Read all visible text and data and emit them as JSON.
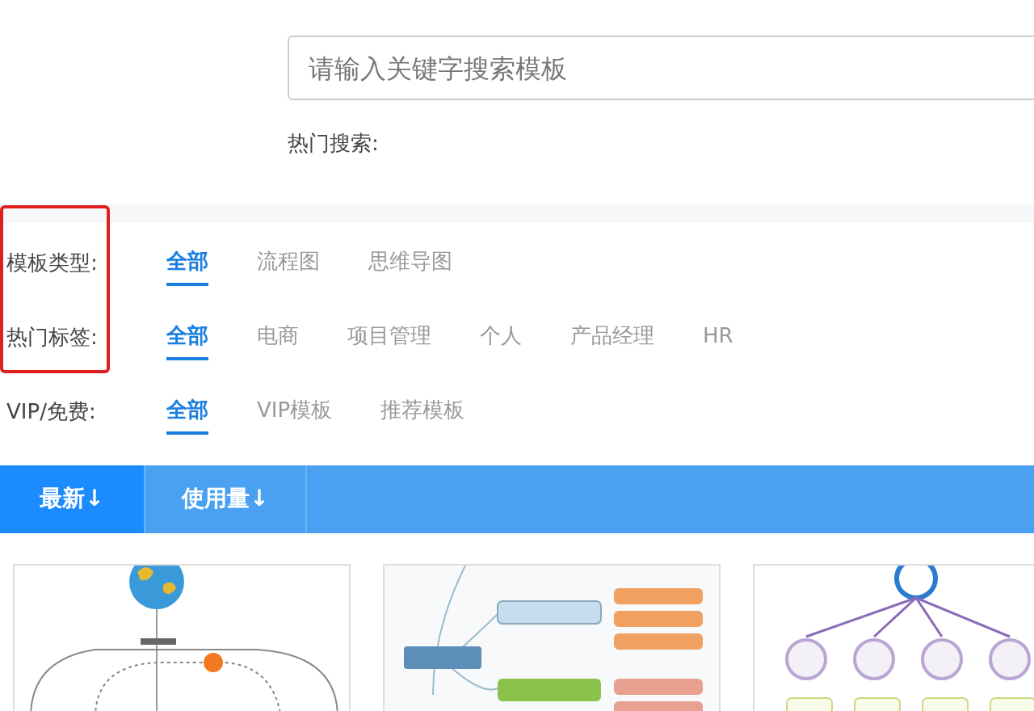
{
  "search": {
    "placeholder": "请输入关键字搜索模板"
  },
  "hot_search": {
    "label": "热门搜索:"
  },
  "filters": [
    {
      "label": "模板类型:",
      "options": [
        {
          "label": "全部",
          "selected": true
        },
        {
          "label": "流程图",
          "selected": false
        },
        {
          "label": "思维导图",
          "selected": false
        }
      ]
    },
    {
      "label": "热门标签:",
      "options": [
        {
          "label": "全部",
          "selected": true
        },
        {
          "label": "电商",
          "selected": false
        },
        {
          "label": "项目管理",
          "selected": false
        },
        {
          "label": "个人",
          "selected": false
        },
        {
          "label": "产品经理",
          "selected": false
        },
        {
          "label": "HR",
          "selected": false
        }
      ]
    },
    {
      "label": "VIP/免费:",
      "options": [
        {
          "label": "全部",
          "selected": true
        },
        {
          "label": "VIP模板",
          "selected": false
        },
        {
          "label": "推荐模板",
          "selected": false
        }
      ]
    }
  ],
  "sort_tabs": [
    {
      "label": "最新↓",
      "selected": true
    },
    {
      "label": "使用量↓",
      "selected": false
    }
  ],
  "templates": [
    {
      "kind": "network"
    },
    {
      "kind": "mindmap"
    },
    {
      "kind": "org"
    }
  ]
}
